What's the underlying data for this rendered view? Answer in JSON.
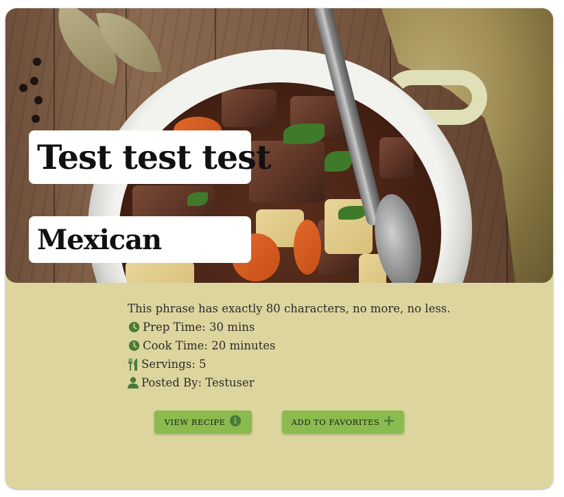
{
  "recipe": {
    "title": "Test test test",
    "cuisine": "Mexican",
    "description": "This phrase has exactly 80 characters, no more, no less.",
    "prep_time": "Prep Time: 30 mins",
    "cook_time": "Cook Time: 20 minutes",
    "servings": "Servings: 5",
    "posted_by": "Posted By: Testuser"
  },
  "actions": {
    "view_label": "View Recipe",
    "favorites_label": "Add to Favorites"
  },
  "icons": {
    "prep": "clock-icon",
    "cook": "clock-icon",
    "servings": "utensils-icon",
    "author": "user-icon",
    "view": "info-icon",
    "favorites": "plus-icon"
  },
  "colors": {
    "card_background": "#ddd59e",
    "button_background": "#8bbb4e",
    "icon_green": "#4a7a3a"
  }
}
